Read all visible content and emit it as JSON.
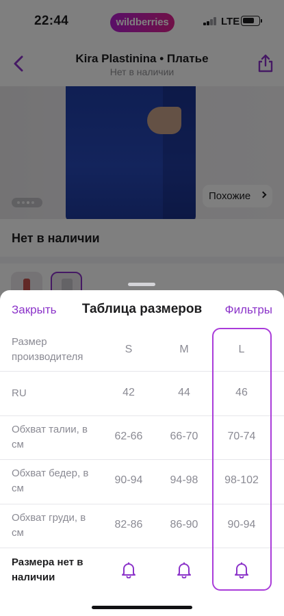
{
  "status_bar": {
    "time": "22:44",
    "brand": "wildberries",
    "network": "LTE"
  },
  "nav": {
    "title": "Kira Plastinina • Платье",
    "subtitle": "Нет в наличии"
  },
  "photo": {
    "similar_label": "Похожие"
  },
  "product": {
    "stock_status": "Нет в наличии"
  },
  "sheet": {
    "close_label": "Закрыть",
    "title": "Таблица размеров",
    "filters_label": "Фильтры",
    "header": {
      "label": "Размер производителя",
      "sizes": [
        "S",
        "M",
        "L"
      ]
    },
    "rows": [
      {
        "label": "RU",
        "values": [
          "42",
          "44",
          "46"
        ]
      },
      {
        "label": "Обхват талии, в см",
        "values": [
          "62-66",
          "66-70",
          "70-74"
        ]
      },
      {
        "label": "Обхват бедер, в см",
        "values": [
          "90-94",
          "94-98",
          "98-102"
        ]
      },
      {
        "label": "Обхват груди, в см",
        "values": [
          "82-86",
          "86-90",
          "90-94"
        ]
      }
    ],
    "notify_row": {
      "label": "Размера нет в наличии"
    },
    "selected_size": "L"
  },
  "colors": {
    "accent": "#8b33c9",
    "highlight": "#a93bd9",
    "brand_gradient_start": "#b31fd0",
    "brand_gradient_end": "#e0218f"
  },
  "icons": [
    "back-chevron-icon",
    "share-icon",
    "signal-icon",
    "battery-icon",
    "chevron-right-icon",
    "bell-icon"
  ]
}
